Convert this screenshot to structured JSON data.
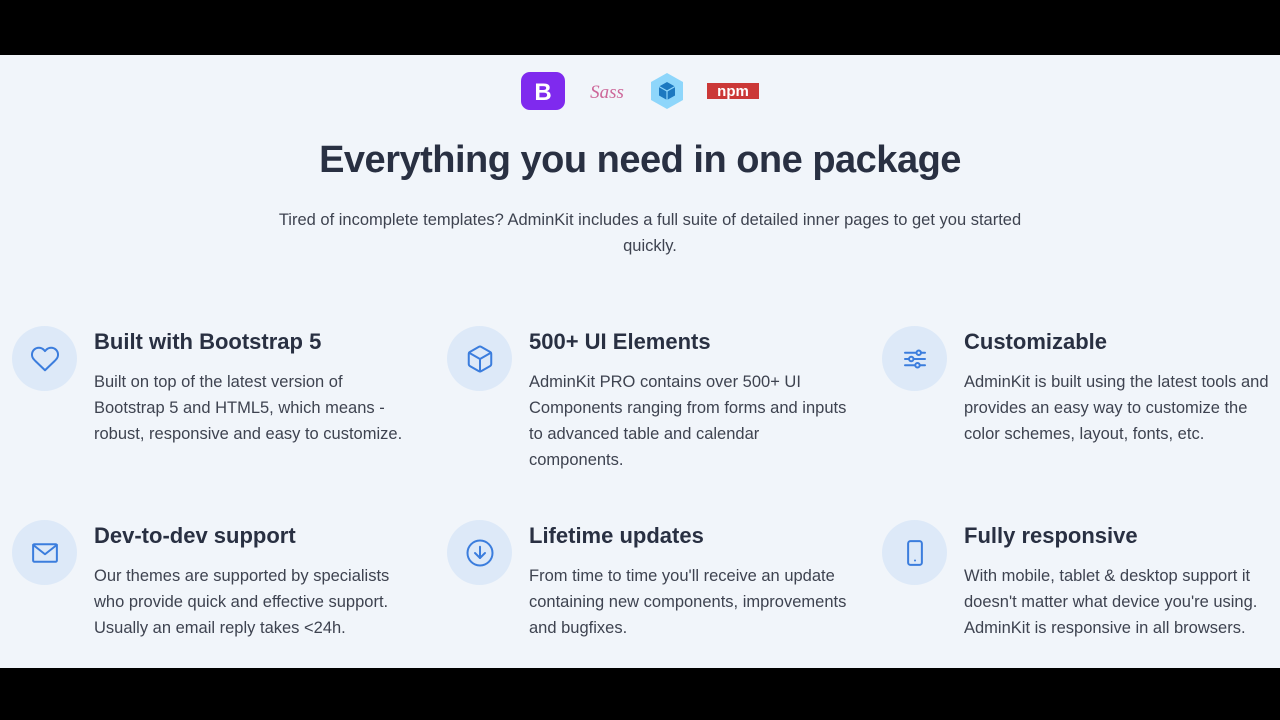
{
  "logos": [
    {
      "name": "bootstrap",
      "text": "B",
      "color": "#7f2aee"
    },
    {
      "name": "sass",
      "text": "Sass",
      "color": "#cd6799"
    },
    {
      "name": "webpack",
      "color": "#1c78c0"
    },
    {
      "name": "npm",
      "text": "npm",
      "color": "#cb3837"
    }
  ],
  "headline": "Everything you need in one package",
  "subtext": "Tired of incomplete templates? AdminKit includes a full suite of detailed inner pages to get you started quickly.",
  "accent_color": "#3b7ddd",
  "features": [
    {
      "icon": "heart-icon",
      "title": "Built with Bootstrap 5",
      "desc": "Built on top of the latest version of Bootstrap 5 and HTML5, which means - robust, responsive and easy to customize."
    },
    {
      "icon": "cube-icon",
      "title": "500+ UI Elements",
      "desc": "AdminKit PRO contains over 500+ UI Components ranging from forms and inputs to advanced table and calendar components."
    },
    {
      "icon": "sliders-icon",
      "title": "Customizable",
      "desc": "AdminKit is built using the latest tools and provides an easy way to customize the color schemes, layout, fonts, etc."
    },
    {
      "icon": "mail-icon",
      "title": "Dev-to-dev support",
      "desc": "Our themes are supported by specialists who provide quick and effective support. Usually an email reply takes <24h."
    },
    {
      "icon": "download-circle-icon",
      "title": "Lifetime updates",
      "desc": "From time to time you'll receive an update containing new components, improvements and bugfixes."
    },
    {
      "icon": "smartphone-icon",
      "title": "Fully responsive",
      "desc": "With mobile, tablet & desktop support it doesn't matter what device you're using. AdminKit is responsive in all browsers."
    }
  ]
}
